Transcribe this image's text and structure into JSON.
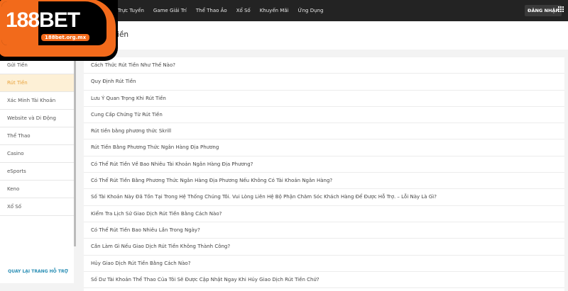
{
  "brand": {
    "logo_text": "188BET",
    "logo_domain": "188bet.org.mx",
    "accent": "#f26a1b"
  },
  "nav": [
    "Casino Trực Tuyến",
    "Game Giải Trí",
    "Thể Thao Ảo",
    "Xổ Số",
    "Khuyến Mãi",
    "Ứng Dụng"
  ],
  "login_label": "ĐĂNG NHẬP",
  "page_title": "Rút Tiền",
  "sidebar": {
    "items": [
      "Gửi Tiền",
      "Rút Tiền",
      "Xác Minh Tài Khoản",
      "Website và Di Động",
      "Thể Thao",
      "Casino",
      "eSports",
      "Keno",
      "Xổ Số"
    ],
    "active": "Rút Tiền",
    "back_link": "QUAY LẠI TRANG HỖ TRỢ"
  },
  "questions": [
    "Cách Thức Rút Tiền Như Thế Nào?",
    "Quy Định Rút Tiền",
    "Lưu Ý Quan Trọng Khi Rút Tiền",
    "Cung Cấp Chứng Từ Rút Tiền",
    "Rút tiền bằng phương thức Skrill",
    "Rút Tiền Bằng Phương Thức Ngân Hàng Địa Phương",
    "Có Thể Rút Tiền Về Bao Nhiêu Tài Khoản Ngân Hàng Địa Phương?",
    "Có Thể Rút Tiền Bằng Phương Thức Ngân Hàng Địa Phương Nếu Không Có Tài Khoản Ngân Hàng?",
    "Số Tài Khoản Này Đã Tồn Tại Trong Hệ Thống Chúng Tôi. Vui Lòng Liên Hệ Bộ Phận Chăm Sóc Khách Hàng Để Được Hỗ Trợ. – Lỗi Này Là Gì?",
    "Kiểm Tra Lịch Sử Giao Dịch Rút Tiền Bằng Cách Nào?",
    "Có Thể Rút Tiền Bao Nhiêu Lần Trong Ngày?",
    "Cần Làm Gì Nếu Giao Dịch Rút Tiền Không Thành Công?",
    "Hủy Giao Dịch Rút Tiền Bằng Cách Nào?",
    "Số Dư Tài Khoản Thể Thao Của Tôi Sẽ Được Cập Nhật Ngay Khi Hủy Giao Dịch Rút Tiền Chứ?"
  ]
}
